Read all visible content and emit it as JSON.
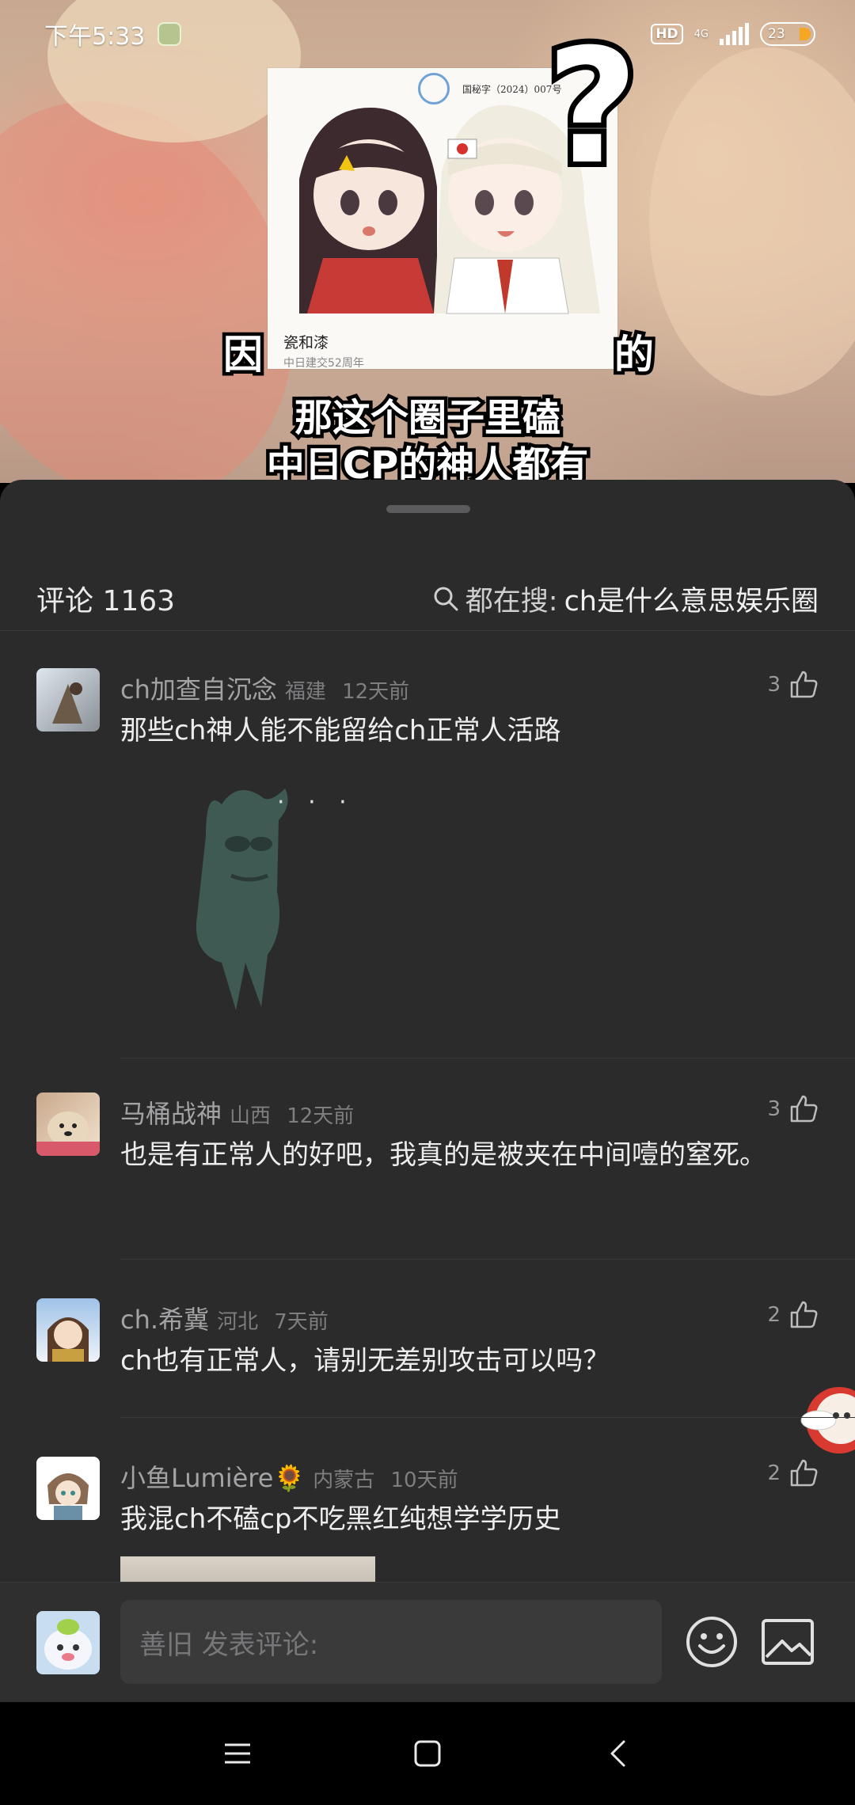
{
  "status_bar": {
    "time": "下午5:33",
    "hd": "HD",
    "network": "4G",
    "battery": "23"
  },
  "video": {
    "doc_number": "国秘字（2024）007号",
    "doc_caption": "瓷和漆",
    "doc_caption2": "中日建交52周年",
    "question_mark": "?",
    "subtitle_line_a": "因",
    "subtitle_line_a2": "的",
    "subtitle_line_b": "那这个圈子里磕",
    "subtitle_line_c": "中日CP的神人都有"
  },
  "comments_panel": {
    "title": "评论 1163",
    "search_prefix": "都在搜:",
    "search_keyword": "ch是什么意思娱乐圈",
    "comments": [
      {
        "user": "ch加查自沉念",
        "location": "福建",
        "time": "12天前",
        "text": "那些ch神人能不能留给ch正常人活路",
        "likes": "3",
        "has_image": true,
        "image_caption": "· · ·"
      },
      {
        "user": "马桶战神",
        "location": "山西",
        "time": "12天前",
        "text": "也是有正常人的好吧，我真的是被夹在中间噎的窒死。",
        "likes": "3"
      },
      {
        "user": "ch.希冀",
        "location": "河北",
        "time": "7天前",
        "text": "ch也有正常人，请别无差别攻击可以吗？",
        "likes": "2"
      },
      {
        "user": "小鱼Lumière🌻",
        "location": "内蒙古",
        "time": "10天前",
        "text": "我混ch不磕cp不吃黑红纯想学学历史",
        "likes": "2"
      }
    ]
  },
  "input_bar": {
    "placeholder": "善旧 发表评论:"
  },
  "colors": {
    "sheet_bg": "#2b2b2c",
    "text_primary": "#ededed",
    "text_secondary": "#a3a3a5",
    "battery_accent": "#f5a623"
  },
  "icons": {
    "search": "search-icon",
    "like": "thumbs-up-icon",
    "emoji": "emoji-icon",
    "image": "image-icon",
    "nav_menu": "menu-icon",
    "nav_home": "home-icon",
    "nav_back": "back-icon"
  }
}
